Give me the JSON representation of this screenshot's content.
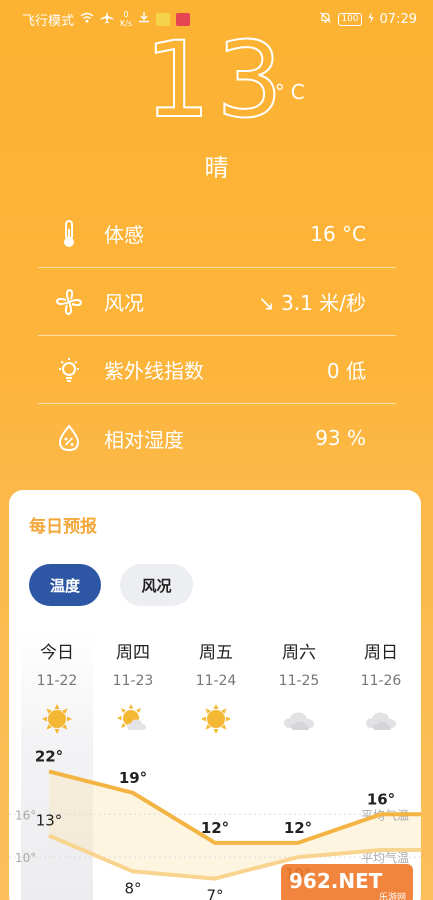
{
  "status_bar": {
    "left_text": "飞行模式",
    "speed_value": "0",
    "speed_unit": "K/s",
    "battery": "100",
    "time": "07:29"
  },
  "current": {
    "temperature": "13",
    "unit": "°C",
    "condition": "晴"
  },
  "details": [
    {
      "icon": "thermometer-icon",
      "label": "体感",
      "value": "16 °C"
    },
    {
      "icon": "fan-icon",
      "label": "风况",
      "value": "↘ 3.1 米/秒"
    },
    {
      "icon": "sun-uv-icon",
      "label": "紫外线指数",
      "value": "0 低"
    },
    {
      "icon": "humidity-drop-icon",
      "label": "相对湿度",
      "value": "93 %"
    }
  ],
  "forecast": {
    "title": "每日预报",
    "tabs": [
      {
        "label": "温度",
        "active": true
      },
      {
        "label": "风况",
        "active": false
      }
    ],
    "days": [
      {
        "name": "今日",
        "date": "11-22",
        "icon": "sunny-icon"
      },
      {
        "name": "周四",
        "date": "11-23",
        "icon": "partly-cloudy-icon"
      },
      {
        "name": "周五",
        "date": "11-24",
        "icon": "sunny-icon"
      },
      {
        "name": "周六",
        "date": "11-25",
        "icon": "cloudy-icon"
      },
      {
        "name": "周日",
        "date": "11-26",
        "icon": "cloudy-icon"
      }
    ]
  },
  "chart_data": {
    "type": "line",
    "categories": [
      "11-22",
      "11-23",
      "11-24",
      "11-25",
      "11-26"
    ],
    "series": [
      {
        "values": [
          22,
          19,
          12,
          12,
          16
        ],
        "color": "#f4b443",
        "labels": [
          "22°",
          "19°",
          "12°",
          "12°",
          "16°"
        ]
      },
      {
        "values": [
          13,
          8,
          7,
          10,
          11
        ],
        "color": "#f8d48f",
        "labels": [
          "13°",
          "8°",
          "7°",
          "10°",
          ""
        ]
      }
    ],
    "reference_lines": [
      {
        "value": 16,
        "label": "16°",
        "name": "平均气温"
      },
      {
        "value": 10,
        "label": "10°",
        "name": "平均气温"
      }
    ],
    "ylim": [
      4,
      25
    ]
  },
  "watermark": {
    "text": "962.NET",
    "subtext": "乐游网"
  },
  "colors": {
    "accent_blue": "#2d57a5",
    "orange": "#fcb232",
    "title_orange": "#f4a73a"
  }
}
